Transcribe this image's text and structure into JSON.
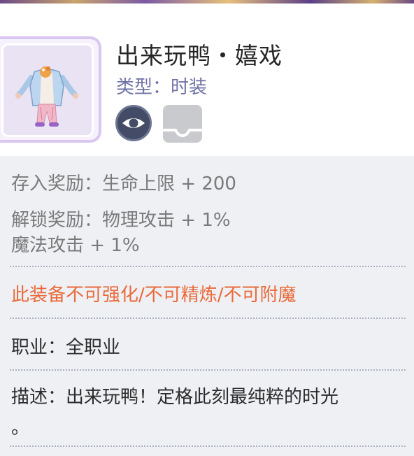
{
  "item": {
    "title": "出来玩鸭・嬉戏",
    "type_line": "类型：时装"
  },
  "actions": {
    "preview_icon": "eye-icon",
    "store_icon": "storage-tray-icon"
  },
  "stats": {
    "deposit_reward": "存入奖励：生命上限 + 200",
    "unlock_reward_line1": "解锁奖励：物理攻击 + 1%",
    "unlock_reward_line2": "魔法攻击 + 1%"
  },
  "restriction": "此装备不可强化/不可精炼/不可附魔",
  "profession": "职业：全职业",
  "description": {
    "line1": "描述：出来玩鸭！定格此刻最纯粹的时光",
    "line2": "。"
  },
  "colors": {
    "accent_frame": "#d9c7f2",
    "title": "#262626",
    "type_text": "#6f72a6",
    "restriction": "#ea6a3a",
    "panel_bg": "#eef0f4"
  }
}
